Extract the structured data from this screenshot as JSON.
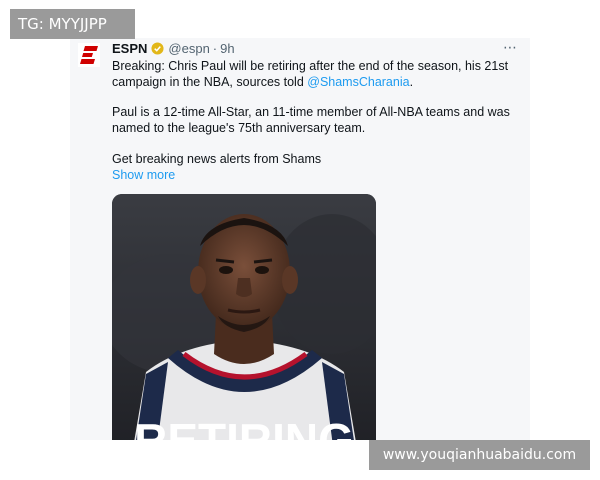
{
  "overlay": {
    "tg_label": "TG: MYYJJPP",
    "watermark_url": "www.youqianhuabaidu.com"
  },
  "tweet": {
    "author_name": "ESPN",
    "handle": "@espn",
    "separator": "·",
    "age": "9h",
    "more_icon": "⋯",
    "paragraph1_text": "Breaking: Chris Paul will be retiring after the end of the season, his 21st campaign in the NBA, sources told ",
    "paragraph1_mention": "@ShamsCharania",
    "paragraph1_end": ".",
    "paragraph2": "Paul is a 12-time All-Star, an 11-time member of All-NBA teams and was named to the league's 75th anniversary team.",
    "paragraph3": "Get breaking news alerts from Shams",
    "show_more": "Show more",
    "media_caption": "RETIRING"
  },
  "colors": {
    "link": "#1d9bf0",
    "espn_red": "#d00000",
    "verified_gold": "#e2b719",
    "muted": "#536471"
  },
  "icons": {
    "logo": "espn-logo-icon",
    "verified": "verified-badge-icon",
    "more": "more-options-icon"
  }
}
